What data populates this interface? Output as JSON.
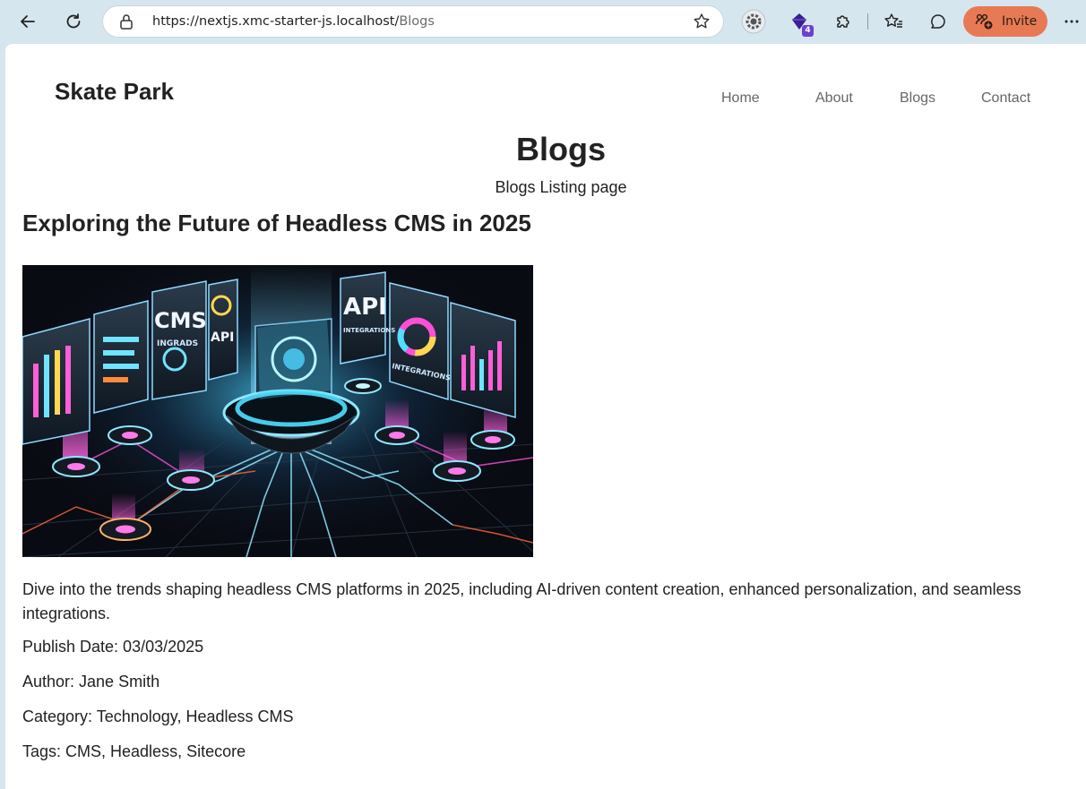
{
  "browser": {
    "url_host": "https://nextjs.xmc-starter-js.localhost/",
    "url_path": "Blogs",
    "extension_badge": "4",
    "invite_label": "Invite",
    "accent": "#e77a54",
    "icons": [
      "back-icon",
      "refresh-icon",
      "lock-icon",
      "favorite-star-icon",
      "settings-extension-icon",
      "extension-gem-icon",
      "puzzle-icon",
      "favorites-icon",
      "copilot-chat-icon",
      "invite-people-icon",
      "more-icon"
    ]
  },
  "site": {
    "brand": "Skate Park",
    "nav": [
      "Home",
      "About",
      "Blogs",
      "Contact"
    ]
  },
  "page": {
    "title": "Blogs",
    "subtitle": "Blogs Listing page"
  },
  "post": {
    "title": "Exploring the Future of Headless CMS in 2025",
    "image_text": [
      "CMS",
      "INGRADS",
      "API",
      "API",
      "INTEGRATIONS",
      "INTEGRATIONS"
    ],
    "description": "Dive into the trends shaping headless CMS platforms in 2025, including AI-driven content creation, enhanced personalization, and seamless integrations.",
    "publish_date": "Publish Date: 03/03/2025",
    "author": "Author: Jane Smith",
    "category": "Category: Technology, Headless CMS",
    "tags": "Tags: CMS, Headless, Sitecore"
  }
}
